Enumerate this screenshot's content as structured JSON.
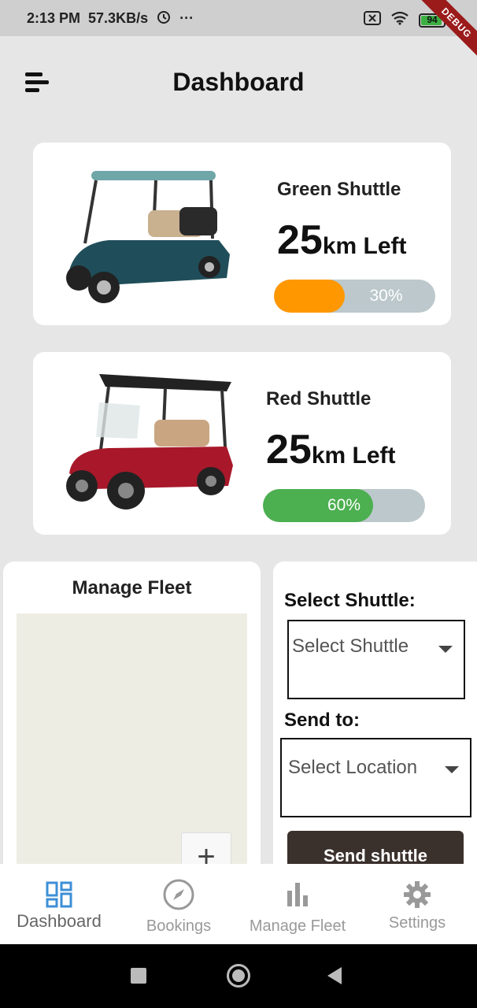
{
  "status_bar": {
    "time": "2:13 PM",
    "speed": "57.3KB/s",
    "more": "···",
    "battery": "94",
    "debug_label": "DEBUG"
  },
  "app_bar": {
    "title": "Dashboard"
  },
  "shuttles": [
    {
      "name": "Green Shuttle",
      "km_value": "25",
      "km_unit": "km Left",
      "progress_label": "30%",
      "progress": 0.3,
      "color": "#ff9800",
      "body_color": "#1f4e5a"
    },
    {
      "name": "Red Shuttle",
      "km_value": "25",
      "km_unit": "km Left",
      "progress_label": "60%",
      "progress": 0.6,
      "color": "#4caf50",
      "body_color": "#a8182a"
    }
  ],
  "fleet": {
    "title": "Manage Fleet",
    "zoom_in": "+"
  },
  "send_panel": {
    "shuttle_label": "Select Shuttle:",
    "shuttle_placeholder": "Select Shuttle",
    "location_label": "Send to:",
    "location_placeholder": "Select Location",
    "send_button": "Send shuttle"
  },
  "bottom_nav": [
    {
      "label": "Dashboard",
      "icon": "dashboard-icon",
      "active": true
    },
    {
      "label": "Bookings",
      "icon": "compass-icon",
      "active": false
    },
    {
      "label": "Manage Fleet",
      "icon": "bar-chart-icon",
      "active": false
    },
    {
      "label": "Settings",
      "icon": "gear-icon",
      "active": false
    }
  ],
  "colors": {
    "accent_active": "#3d8fd6",
    "inactive": "#999999",
    "send_button": "#3a302c",
    "map_bg": "#eeede4"
  }
}
